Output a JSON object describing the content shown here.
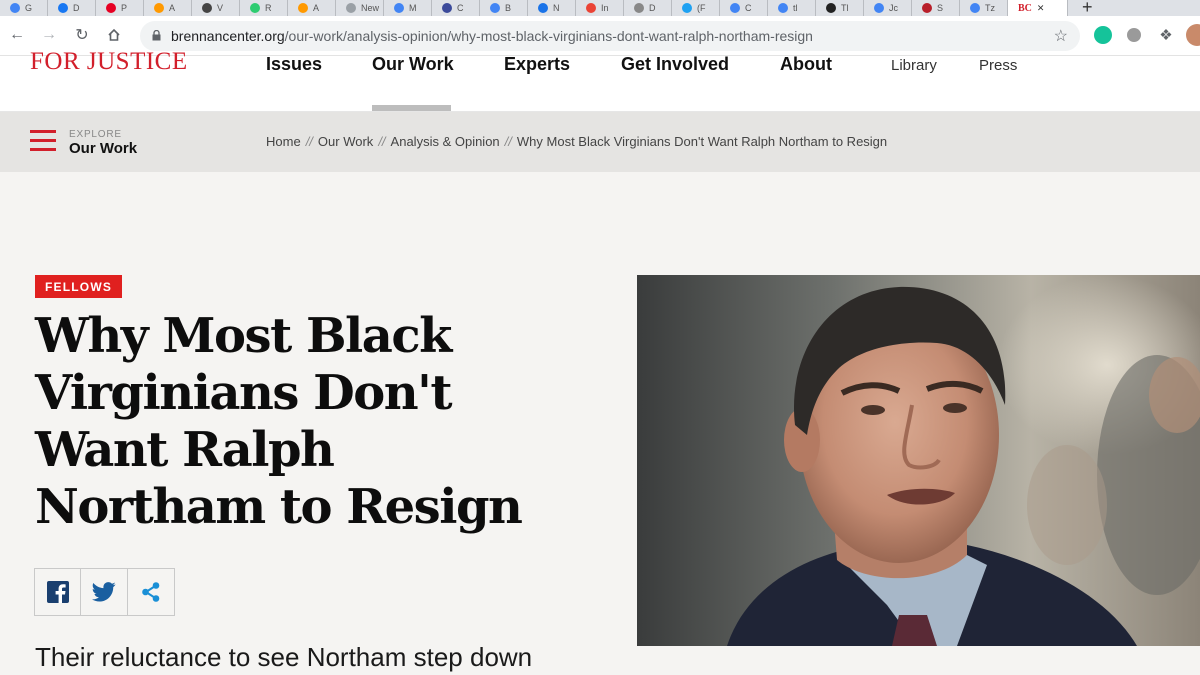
{
  "browser": {
    "tabs": [
      {
        "label": "G",
        "color": "#4285f4"
      },
      {
        "label": "D",
        "color": "#1877f2"
      },
      {
        "label": "P",
        "color": "#e60023"
      },
      {
        "label": "A",
        "color": "#ff9900"
      },
      {
        "label": "V",
        "color": "#444444"
      },
      {
        "label": "R",
        "color": "#2ecc71"
      },
      {
        "label": "A",
        "color": "#ff9900"
      },
      {
        "label": "New",
        "color": "#9aa0a6"
      },
      {
        "label": "M",
        "color": "#4285f4"
      },
      {
        "label": "C",
        "color": "#3b4a9a"
      },
      {
        "label": "B",
        "color": "#4285f4"
      },
      {
        "label": "N",
        "color": "#1a73e8"
      },
      {
        "label": "In",
        "color": "#ea4335"
      },
      {
        "label": "D",
        "color": "#888888"
      },
      {
        "label": "(F",
        "color": "#1da1f2"
      },
      {
        "label": "C",
        "color": "#4285f4"
      },
      {
        "label": "tl",
        "color": "#4285f4"
      },
      {
        "label": "Tl",
        "color": "#222222"
      },
      {
        "label": "Jc",
        "color": "#4285f4"
      },
      {
        "label": "S",
        "color": "#b81f2a"
      },
      {
        "label": "Tz",
        "color": "#4285f4"
      }
    ],
    "active_tab": {
      "label": "BC",
      "color": "#d21f2b"
    },
    "url_host": "brennancenter.org",
    "url_path": "/our-work/analysis-opinion/why-most-black-virginians-dont-want-ralph-northam-resign"
  },
  "site": {
    "logo": "FOR JUSTICE",
    "nav": [
      "Issues",
      "Our Work",
      "Experts",
      "Get Involved",
      "About"
    ],
    "subnav": [
      "Library",
      "Press"
    ],
    "active_nav": "Our Work"
  },
  "explore": {
    "label": "EXPLORE",
    "value": "Our Work"
  },
  "breadcrumb": [
    "Home",
    "Our Work",
    "Analysis & Opinion",
    "Why Most Black Virginians Don't Want Ralph Northam to Resign"
  ],
  "breadcrumb_separator": "//",
  "article": {
    "badge": "FELLOWS",
    "headline_lines": [
      "Why Most Black",
      "Virginians Don't",
      "Want Ralph",
      "Northam to Resign"
    ],
    "dek": "Their reluctance to see Northam step down"
  },
  "colors": {
    "brand_red": "#d21f2b",
    "badge_red": "#e0201f",
    "facebook_blue": "#1a3f6f",
    "twitter_blue": "#1a5fa0",
    "share_blue": "#1a8fd6"
  },
  "icons": [
    "lock-icon",
    "star-icon",
    "facebook-icon",
    "twitter-icon",
    "share-icon",
    "hamburger-menu-icon"
  ]
}
